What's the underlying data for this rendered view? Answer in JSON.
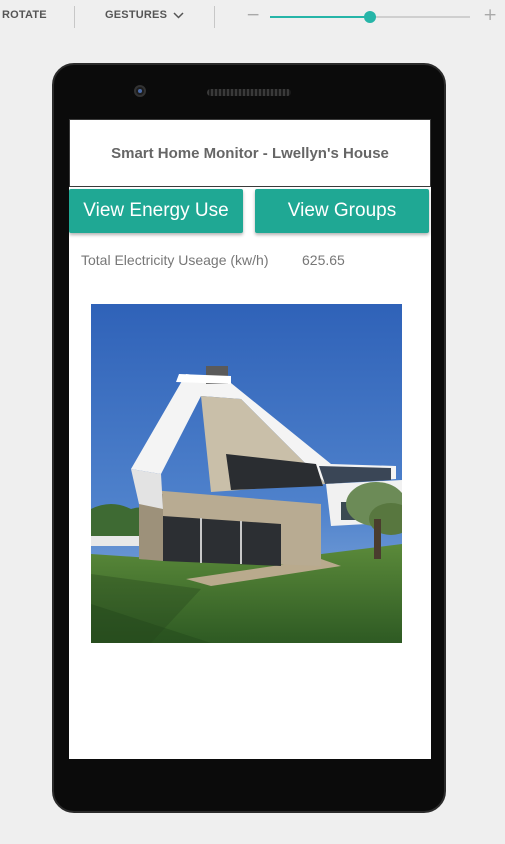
{
  "toolbar": {
    "rotate_label": "ROTATE",
    "gestures_label": "GESTURES",
    "gestures_icon": "chevron-down-icon",
    "zoom_minus": "−",
    "zoom_plus": "+",
    "zoom_level": 0.5,
    "accent_color": "#26b5a8"
  },
  "app": {
    "title": "Smart Home Monitor - Lwellyn's House",
    "buttons": {
      "energy_label": "View Energy Use",
      "groups_label": "View Groups"
    },
    "button_color": "#1fa894",
    "stat": {
      "label": "Total Electricity Useage (kw/h)",
      "value": "625.65"
    },
    "image_alt": "Modern house"
  }
}
